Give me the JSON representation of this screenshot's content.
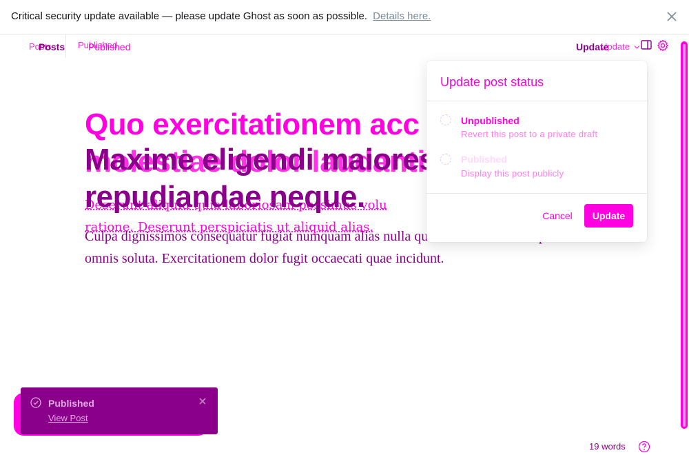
{
  "banner": {
    "message": "Critical security update available — please update Ghost as soon as possible.",
    "link_label": "Details here."
  },
  "header": {
    "posts_label": "Posts",
    "status_label": "Published",
    "update_label": "Update",
    "ghost_posts": "Posts",
    "ghost_published": "Published",
    "ghost_update": "Update"
  },
  "post": {
    "title": "Maxime eligendi maiores rem repudiandae neque.",
    "body_text": "Culpa dignissimos consequatur fugiat numquam alias nulla quos nobis. Veniam explicabo omnis soluta. Exercitationem dolor fugit occaecati quae incidunt."
  },
  "ghost_content": {
    "title_line1": "Quo exercitationem acc",
    "title_line2": "molestiae dolor laudantium",
    "body": "Deserunt aliquid quia laboriosam possimus volu ratione. Deserunt perspiciatis ut aliquid alias."
  },
  "popover": {
    "title": "Update post status",
    "options": [
      {
        "label": "Unpublished",
        "description": "Revert this post to a private draft"
      },
      {
        "label": "Published",
        "description": "Display this post publicly"
      }
    ],
    "cancel_label": "Cancel",
    "update_label": "Update"
  },
  "toast": {
    "title": "Published",
    "link_label": "View Post"
  },
  "footer": {
    "word_count": "19 words"
  },
  "colors": {
    "accent": "#ff00e0",
    "dark_accent": "#8a008a"
  }
}
